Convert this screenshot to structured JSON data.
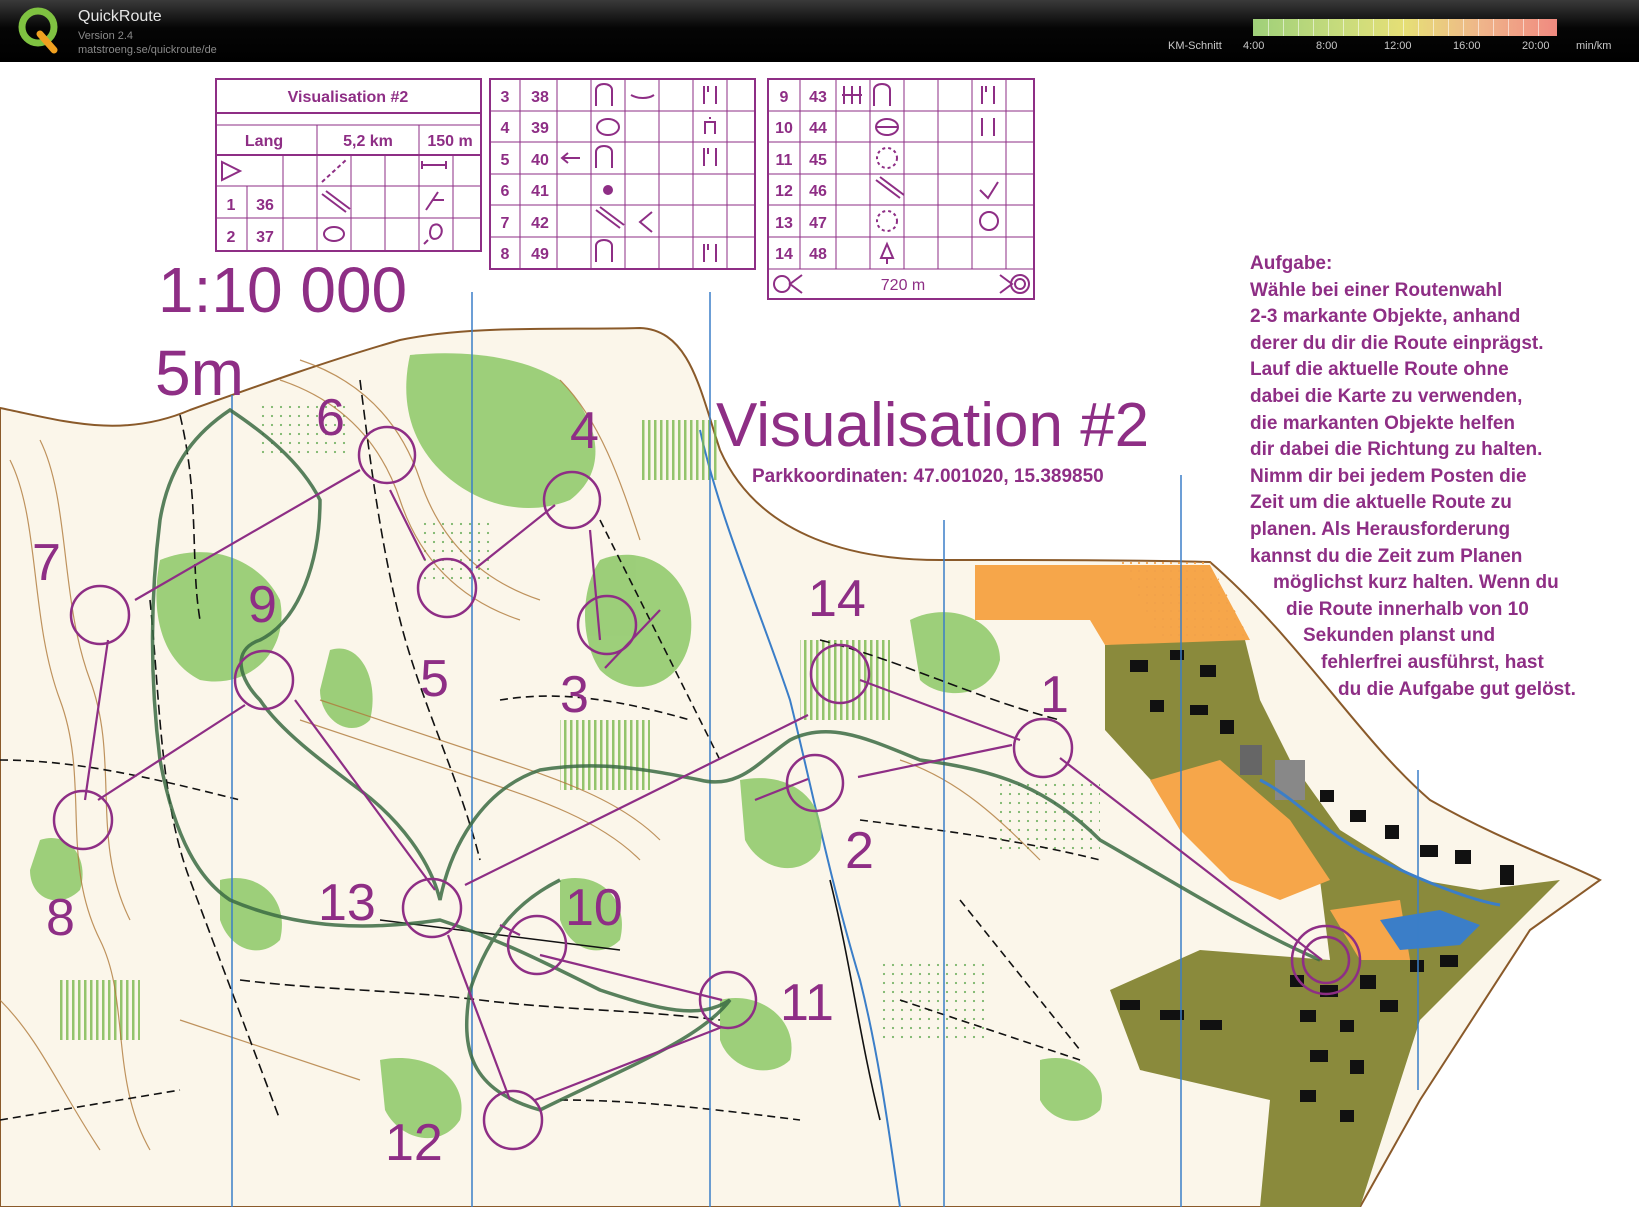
{
  "header": {
    "app_title": "QuickRoute",
    "version": "Version 2.4",
    "url": "matstroeng.se/quickroute/de",
    "logo_icon": "quickroute-q-logo-icon",
    "legend": {
      "label": "KM-Schnitt",
      "ticks": [
        "4:00",
        "8:00",
        "12:00",
        "16:00",
        "20:00"
      ],
      "unit": "min/km",
      "colors": [
        "#9fd07a",
        "#c9dc7c",
        "#e6df76",
        "#efb58a",
        "#f08a80"
      ]
    }
  },
  "map": {
    "scale": "1:10 000",
    "contour": "5m",
    "title": "Visualisation #2",
    "coords": "Parkkoordinaten: 47.001020, 15.389850",
    "control_color": "#8e2e85",
    "route_color": "#3b6b43",
    "description_card": {
      "title": "Visualisation #2",
      "class": "Lang",
      "length": "5,2 km",
      "climb": "150 m",
      "final_distance": "720 m",
      "left_rows": [
        {
          "n": "1",
          "code": "36"
        },
        {
          "n": "2",
          "code": "37"
        }
      ],
      "mid_rows": [
        {
          "n": "3",
          "code": "38"
        },
        {
          "n": "4",
          "code": "39"
        },
        {
          "n": "5",
          "code": "40"
        },
        {
          "n": "6",
          "code": "41"
        },
        {
          "n": "7",
          "code": "42"
        },
        {
          "n": "8",
          "code": "49"
        }
      ],
      "right_rows": [
        {
          "n": "9",
          "code": "43"
        },
        {
          "n": "10",
          "code": "44"
        },
        {
          "n": "11",
          "code": "45"
        },
        {
          "n": "12",
          "code": "46"
        },
        {
          "n": "13",
          "code": "47"
        },
        {
          "n": "14",
          "code": "48"
        }
      ]
    },
    "control_labels": [
      "1",
      "2",
      "3",
      "4",
      "5",
      "6",
      "7",
      "8",
      "9",
      "10",
      "11",
      "12",
      "13",
      "14"
    ]
  },
  "task": {
    "lines": [
      "Aufgabe:",
      "Wähle bei einer Routenwahl",
      "2-3 markante Objekte, anhand",
      "derer du dir die Route einprägst.",
      "Lauf die aktuelle Route ohne",
      "dabei die Karte zu verwenden,",
      "die markanten Objekte helfen",
      "dir dabei die Richtung zu halten.",
      "Nimm dir bei jedem Posten die",
      "Zeit um die aktuelle Route zu",
      "planen. Als Herausforderung",
      "kannst du die Zeit zum Planen",
      "möglichst kurz halten. Wenn du",
      "die Route innerhalb von 10",
      "Sekunden planst und",
      "fehlerfrei ausführst, hast",
      "du die Aufgabe gut gelöst."
    ]
  }
}
